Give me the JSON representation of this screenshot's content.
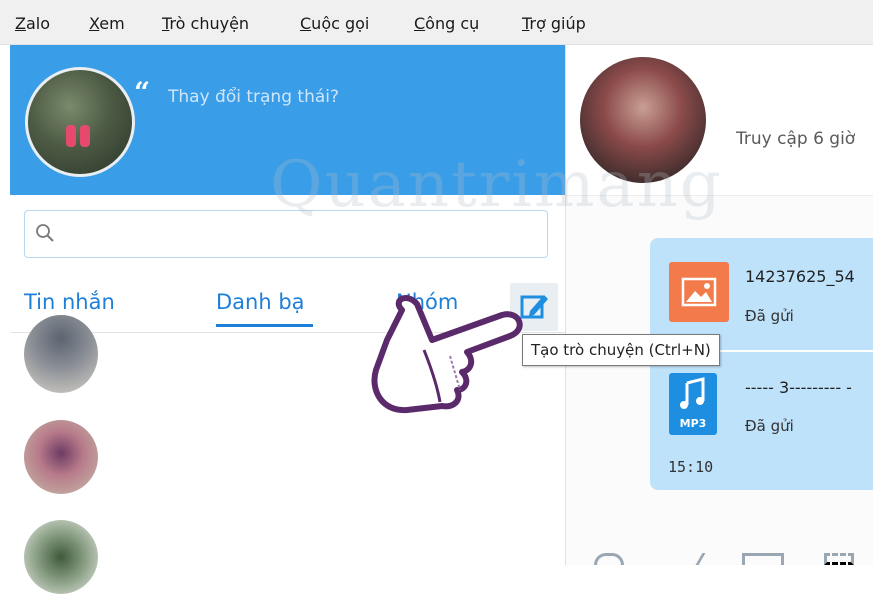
{
  "menu": {
    "items": [
      "Zalo",
      "Xem",
      "Trò chuyện",
      "Cuộc gọi",
      "Công cụ",
      "Trợ giúp"
    ]
  },
  "profile": {
    "status_placeholder": "Thay đổi trạng thái?",
    "quote_icon": "quote-icon"
  },
  "search": {
    "icon": "search-icon",
    "placeholder": ""
  },
  "tabs": {
    "messages": "Tin nhắn",
    "contacts": "Danh bạ",
    "groups": "Nhóm",
    "active": "Danh bạ"
  },
  "compose": {
    "icon": "compose-icon",
    "tooltip": "Tạo trò chuyện (Ctrl+N)"
  },
  "chat": {
    "last_seen": "Truy cập 6 giờ",
    "messages": [
      {
        "file_name": "14237625_54",
        "status": "Đã gửi",
        "icon": "image-file-icon"
      },
      {
        "file_name": "----- 3--------- -",
        "status": "Đã gửi",
        "icon": "mp3-file-icon",
        "icon_label": "MP3"
      }
    ],
    "time": "15:10"
  },
  "watermark": "Quantrimang",
  "colors": {
    "accent": "#3a9de8",
    "tab": "#1e7fd8",
    "bubble": "#bfe2fb",
    "image_icon": "#f37b4b",
    "mp3_icon": "#1e8ee0"
  }
}
